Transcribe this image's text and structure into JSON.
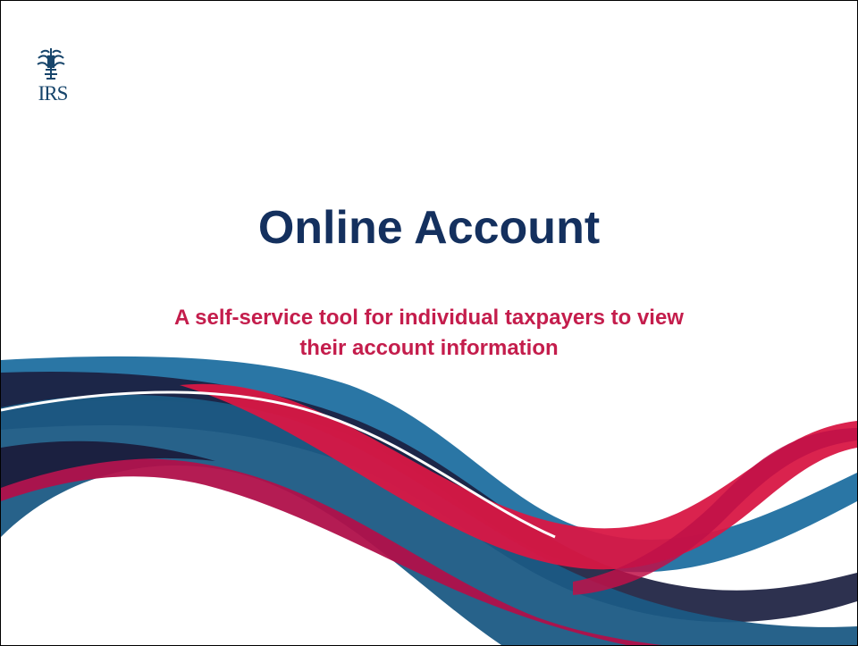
{
  "logo": {
    "text": "IRS",
    "icon": "irs-eagle-logo-icon",
    "color": "#17456b"
  },
  "slide": {
    "title": "Online Account",
    "subtitle_line1": "A self-service tool for individual taxpayers to view",
    "subtitle_line2": "their account information"
  },
  "colors": {
    "title": "#14305e",
    "subtitle": "#c41d4c",
    "wave_blue": "#1a6a98",
    "wave_navy": "#1b2040",
    "wave_red": "#d81744",
    "wave_crimson": "#b0104a"
  }
}
